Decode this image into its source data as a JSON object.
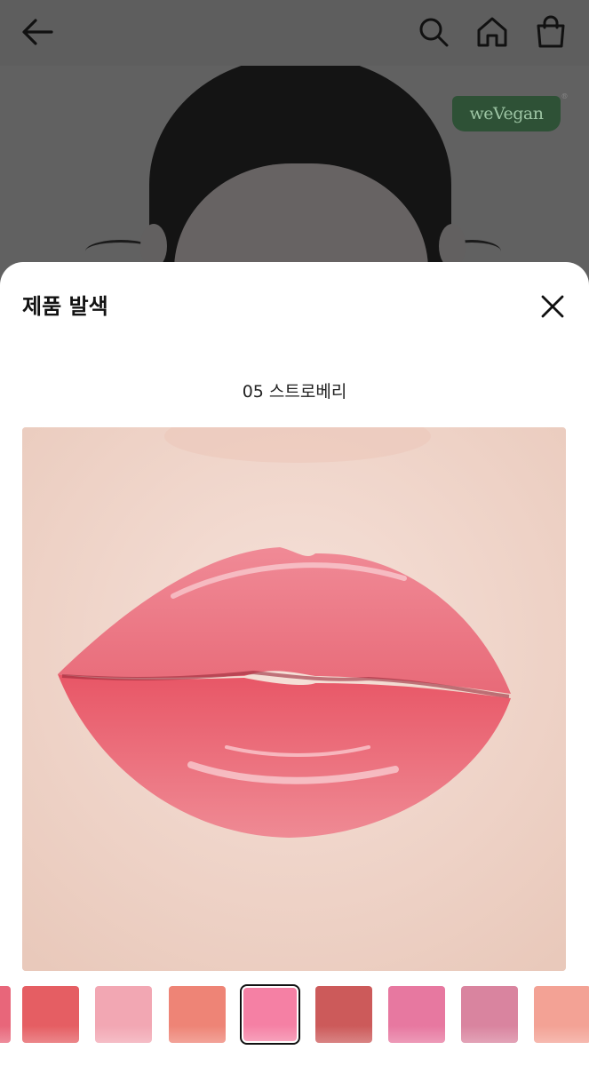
{
  "app_bar": {
    "icons": [
      "back-arrow-icon",
      "search-icon",
      "home-icon",
      "shopping-bag-icon"
    ]
  },
  "hero": {
    "badge_text": "weVegan",
    "badge_mark": "®"
  },
  "sheet": {
    "title": "제품 발색",
    "close_icon": "close-icon",
    "shade_name": "05 스트로베리",
    "photo_alt": "lip swatch"
  },
  "chips": [
    {
      "color": "#e8667a",
      "selected": false
    },
    {
      "color": "#e55e63",
      "selected": false
    },
    {
      "color": "#f2a7b3",
      "selected": false
    },
    {
      "color": "#ee8476",
      "selected": false
    },
    {
      "color": "#f580a4",
      "selected": true
    },
    {
      "color": "#cc5a5a",
      "selected": false
    },
    {
      "color": "#e778a0",
      "selected": false
    },
    {
      "color": "#d9849f",
      "selected": false
    },
    {
      "color": "#f3a295",
      "selected": false
    }
  ]
}
